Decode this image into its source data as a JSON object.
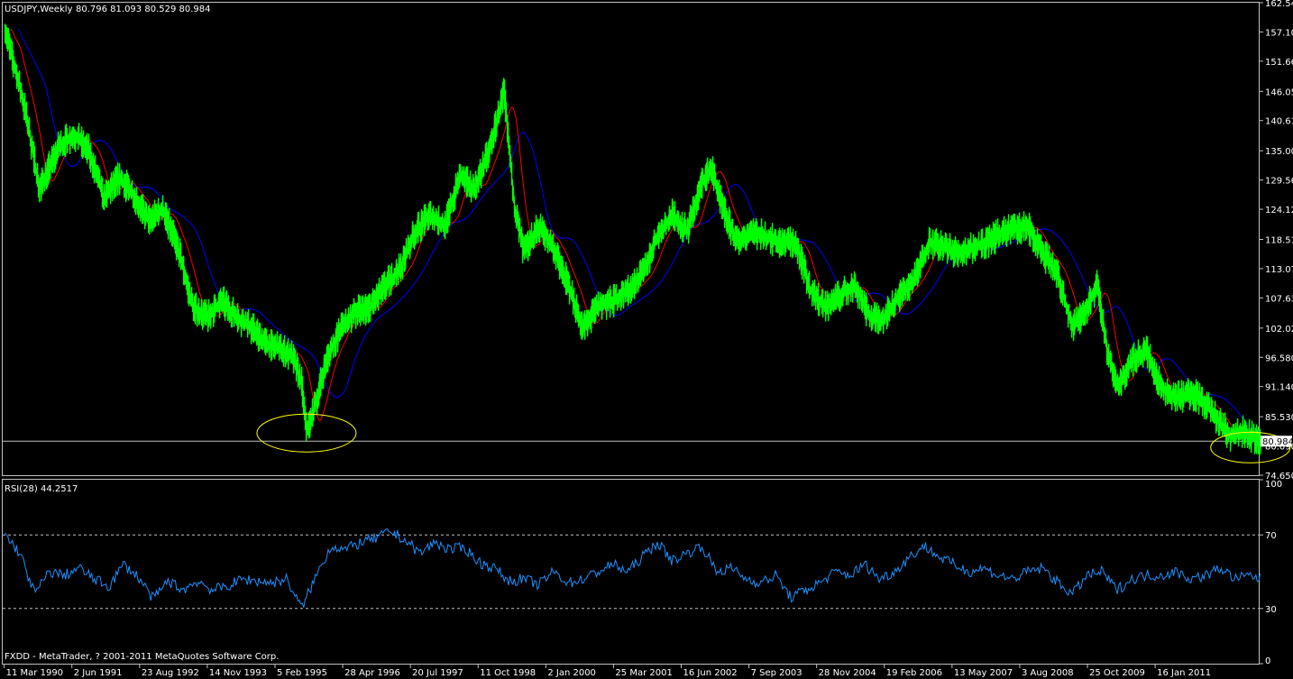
{
  "window": {
    "title": "USDJPY,Weekly",
    "ohlc": "80.796 81.093 80.529 80.984",
    "copyright": "FXDD - MetaTrader, ? 2001-2011 MetaQuotes Software Corp."
  },
  "colors": {
    "background": "#000000",
    "frame": "#c0c0c0",
    "price": "#00ff00",
    "ma_fast": "#ff0000",
    "ma_slow": "#0000ff",
    "rsi": "#1e90ff",
    "current_line": "#c0c0c0",
    "ellipse": "#ffff00",
    "level_lines": "#c0c0c0",
    "price_tag_bg": "#ffffff",
    "price_tag_text": "#000000"
  },
  "chart_data": [
    {
      "type": "line",
      "title": "USDJPY,Weekly",
      "symbol": "USDJPY",
      "timeframe": "Weekly",
      "last_bar": {
        "open": 80.796,
        "high": 81.093,
        "low": 80.529,
        "close": 80.984
      },
      "current_price_label": "80.984",
      "ylim": [
        74.65,
        162.54
      ],
      "y_ticks": [
        "162.540",
        "157.100",
        "151.660",
        "146.050",
        "140.610",
        "135.000",
        "129.560",
        "124.120",
        "118.510",
        "113.070",
        "107.630",
        "102.020",
        "96.580",
        "91.140",
        "85.530",
        "80.090",
        "74.650"
      ],
      "x_ticks": [
        "11 Mar 1990",
        "2 Jun 1991",
        "23 Aug 1992",
        "14 Nov 1993",
        "5 Feb 1995",
        "28 Apr 1996",
        "20 Jul 1997",
        "11 Oct 1998",
        "2 Jan 2000",
        "25 Mar 2001",
        "16 Jun 2002",
        "7 Sep 2003",
        "28 Nov 2004",
        "19 Feb 2006",
        "13 May 2007",
        "3 Aug 2008",
        "25 Oct 2009",
        "16 Jan 2011"
      ],
      "series": [
        {
          "role": "price",
          "x": [
            "1990-03",
            "1990-04",
            "1990-07",
            "1990-10",
            "1991-02",
            "1991-05",
            "1991-08",
            "1991-11",
            "1992-02",
            "1992-05",
            "1992-08",
            "1992-11",
            "1993-02",
            "1993-05",
            "1993-08",
            "1993-11",
            "1994-02",
            "1994-05",
            "1994-08",
            "1994-11",
            "1995-01",
            "1995-03",
            "1995-04",
            "1995-05",
            "1995-08",
            "1995-11",
            "1996-02",
            "1996-05",
            "1996-08",
            "1996-11",
            "1997-02",
            "1997-05",
            "1997-08",
            "1997-11",
            "1998-02",
            "1998-05",
            "1998-08",
            "1998-10",
            "1998-12",
            "1999-03",
            "1999-06",
            "1999-09",
            "1999-12",
            "2000-03",
            "2000-06",
            "2000-09",
            "2000-12",
            "2001-03",
            "2001-06",
            "2001-09",
            "2001-12",
            "2002-02",
            "2002-04",
            "2002-07",
            "2002-10",
            "2003-01",
            "2003-04",
            "2003-07",
            "2003-10",
            "2004-01",
            "2004-04",
            "2004-07",
            "2004-10",
            "2005-01",
            "2005-04",
            "2005-07",
            "2005-10",
            "2006-01",
            "2006-04",
            "2006-07",
            "2006-10",
            "2007-01",
            "2007-06",
            "2007-09",
            "2007-12",
            "2008-03",
            "2008-06",
            "2008-08",
            "2008-10",
            "2008-12",
            "2009-03",
            "2009-06",
            "2009-09",
            "2009-12",
            "2010-03",
            "2010-06",
            "2010-09",
            "2010-11",
            "2011-01",
            "2011-03",
            "2011-05"
          ],
          "y": [
            158,
            154,
            143,
            128,
            136,
            138,
            135,
            126,
            130,
            127,
            122,
            124,
            117,
            106,
            104,
            107,
            104,
            102,
            99,
            98,
            97,
            92,
            83,
            85,
            96,
            102,
            105,
            106,
            110,
            113,
            120,
            123,
            121,
            130,
            128,
            135,
            146,
            125,
            116,
            121,
            117,
            110,
            102,
            106,
            107,
            109,
            112,
            119,
            123,
            120,
            129,
            132,
            125,
            118,
            120,
            119,
            118,
            118,
            109,
            106,
            108,
            110,
            104,
            104,
            108,
            111,
            118,
            117,
            116,
            117,
            118,
            120,
            121,
            116,
            112,
            102,
            106,
            110,
            98,
            91,
            96,
            98,
            91,
            89,
            90,
            88,
            84,
            82,
            83,
            82,
            81
          ]
        },
        {
          "role": "ma_fast"
        },
        {
          "role": "ma_slow"
        }
      ],
      "annotations": [
        {
          "type": "ellipse",
          "date": "1995-04",
          "value": 82.5
        },
        {
          "type": "ellipse",
          "date": "2011-03",
          "value": 79.8
        }
      ]
    },
    {
      "type": "line",
      "title": "RSI(28) 44.2517",
      "indicator": "RSI(28)",
      "last_value": 44.2517,
      "ylim": [
        0,
        100
      ],
      "y_ticks": [
        "100",
        "70",
        "30",
        "0"
      ],
      "levels": [
        70,
        30
      ],
      "series": [
        {
          "x": [
            "1990-03",
            "1990-06",
            "1990-09",
            "1990-12",
            "1991-03",
            "1991-06",
            "1991-09",
            "1991-12",
            "1992-03",
            "1992-06",
            "1992-09",
            "1992-12",
            "1993-03",
            "1993-06",
            "1993-09",
            "1993-12",
            "1994-03",
            "1994-06",
            "1994-09",
            "1994-12",
            "1995-03",
            "1995-06",
            "1995-09",
            "1995-12",
            "1996-03",
            "1996-06",
            "1996-09",
            "1996-12",
            "1997-03",
            "1997-06",
            "1997-09",
            "1997-12",
            "1998-03",
            "1998-06",
            "1998-09",
            "1998-12",
            "1999-03",
            "1999-06",
            "1999-09",
            "1999-12",
            "2000-03",
            "2000-06",
            "2000-09",
            "2000-12",
            "2001-03",
            "2001-06",
            "2001-09",
            "2001-12",
            "2002-03",
            "2002-06",
            "2002-09",
            "2002-12",
            "2003-03",
            "2003-06",
            "2003-09",
            "2003-12",
            "2004-03",
            "2004-06",
            "2004-09",
            "2004-12",
            "2005-03",
            "2005-06",
            "2005-09",
            "2005-12",
            "2006-03",
            "2006-06",
            "2006-09",
            "2006-12",
            "2007-03",
            "2007-06",
            "2007-09",
            "2007-12",
            "2008-03",
            "2008-06",
            "2008-09",
            "2008-12",
            "2009-03",
            "2009-06",
            "2009-09",
            "2009-12",
            "2010-03",
            "2010-06",
            "2010-09",
            "2010-12",
            "2011-03",
            "2011-05"
          ],
          "y": [
            70,
            60,
            38,
            50,
            48,
            52,
            46,
            42,
            54,
            47,
            35,
            45,
            40,
            45,
            40,
            42,
            46,
            45,
            44,
            46,
            30,
            48,
            64,
            62,
            66,
            68,
            72,
            67,
            60,
            66,
            62,
            63,
            55,
            52,
            45,
            46,
            43,
            50,
            44,
            46,
            50,
            54,
            50,
            58,
            66,
            56,
            60,
            64,
            50,
            52,
            46,
            44,
            48,
            36,
            40,
            44,
            50,
            48,
            54,
            46,
            50,
            58,
            64,
            58,
            54,
            50,
            52,
            48,
            46,
            50,
            52,
            44,
            38,
            48,
            50,
            40,
            46,
            48,
            48,
            50,
            46,
            48,
            52,
            46,
            48,
            46
          ]
        }
      ]
    }
  ]
}
